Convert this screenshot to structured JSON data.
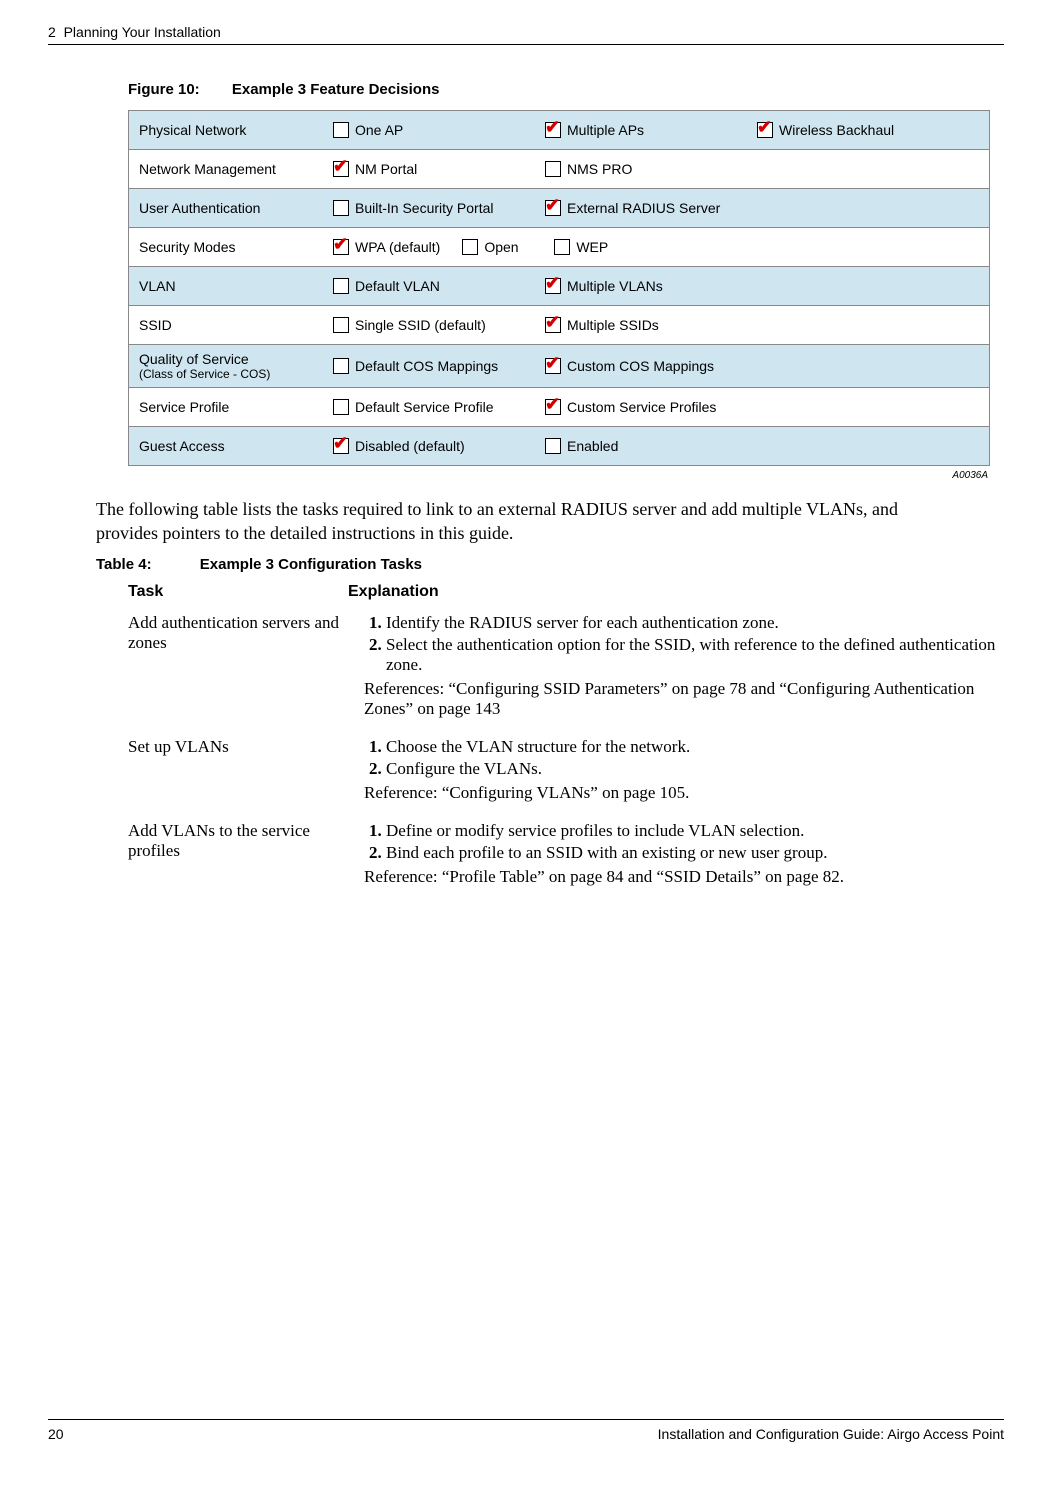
{
  "header": {
    "chapter": "2",
    "chapter_title": "Planning Your Installation"
  },
  "figure": {
    "number": "Figure 10:",
    "title": "Example 3 Feature Decisions",
    "id_code": "A0036A",
    "rows": [
      {
        "shaded": true,
        "label": "Physical Network",
        "sublabel": "",
        "options": [
          {
            "text": "One AP",
            "checked": false
          },
          {
            "text": "Multiple APs",
            "checked": true
          },
          {
            "text": "Wireless Backhaul",
            "checked": true
          }
        ]
      },
      {
        "shaded": false,
        "label": "Network Management",
        "sublabel": "",
        "options": [
          {
            "text": "NM Portal",
            "checked": true
          },
          {
            "text": "NMS PRO",
            "checked": false
          }
        ]
      },
      {
        "shaded": true,
        "label": "User Authentication",
        "sublabel": "",
        "options": [
          {
            "text": "Built-In Security Portal",
            "checked": false
          },
          {
            "text": "External RADIUS Server",
            "checked": true
          }
        ]
      },
      {
        "shaded": false,
        "label": "Security Modes",
        "sublabel": "",
        "options": [
          {
            "text": "WPA (default)",
            "checked": true,
            "narrow": true
          },
          {
            "text": "Open",
            "checked": false,
            "narrow": true
          },
          {
            "text": "WEP",
            "checked": false
          }
        ]
      },
      {
        "shaded": true,
        "label": "VLAN",
        "sublabel": "",
        "options": [
          {
            "text": "Default VLAN",
            "checked": false
          },
          {
            "text": "Multiple VLANs",
            "checked": true
          }
        ]
      },
      {
        "shaded": false,
        "label": "SSID",
        "sublabel": "",
        "options": [
          {
            "text": "Single SSID (default)",
            "checked": false
          },
          {
            "text": "Multiple SSIDs",
            "checked": true
          }
        ]
      },
      {
        "shaded": true,
        "label": "Quality of Service",
        "sublabel": "(Class of Service - COS)",
        "options": [
          {
            "text": "Default COS Mappings",
            "checked": false
          },
          {
            "text": "Custom COS Mappings",
            "checked": true
          }
        ]
      },
      {
        "shaded": false,
        "label": "Service Profile",
        "sublabel": "",
        "options": [
          {
            "text": "Default Service Profile",
            "checked": false
          },
          {
            "text": "Custom Service Profiles",
            "checked": true
          }
        ]
      },
      {
        "shaded": true,
        "label": "Guest Access",
        "sublabel": "",
        "options": [
          {
            "text": "Disabled (default)",
            "checked": true
          },
          {
            "text": "Enabled",
            "checked": false
          }
        ]
      }
    ]
  },
  "body_paragraph": "The following table lists the tasks required to link to an external RADIUS server and add multiple VLANs, and provides pointers to the detailed instructions in this guide.",
  "table": {
    "number": "Table 4:",
    "title": "Example 3 Configuration Tasks",
    "head_task": "Task",
    "head_exp": "Explanation",
    "rows": [
      {
        "task": "Add authentication servers and zones",
        "steps": [
          "Identify the RADIUS server for each authentication zone.",
          "Select the authentication option for the SSID, with reference to the defined authentication zone."
        ],
        "reference": "References: “Configuring SSID Parameters” on page 78 and “Configuring Authentication Zones” on page 143"
      },
      {
        "task": "Set up VLANs",
        "steps": [
          "Choose the VLAN structure for the network.",
          "Configure the VLANs."
        ],
        "reference": "Reference: “Configuring VLANs” on page 105."
      },
      {
        "task": "Add VLANs to the service profiles",
        "steps": [
          "Define or modify service profiles to include VLAN selection.",
          "Bind each profile to an SSID with an existing or new user group."
        ],
        "reference": "Reference: “Profile Table” on page 84 and “SSID Details” on page 82."
      }
    ]
  },
  "footer": {
    "page": "20",
    "doc_title": "Installation and Configuration Guide: Airgo Access Point"
  }
}
